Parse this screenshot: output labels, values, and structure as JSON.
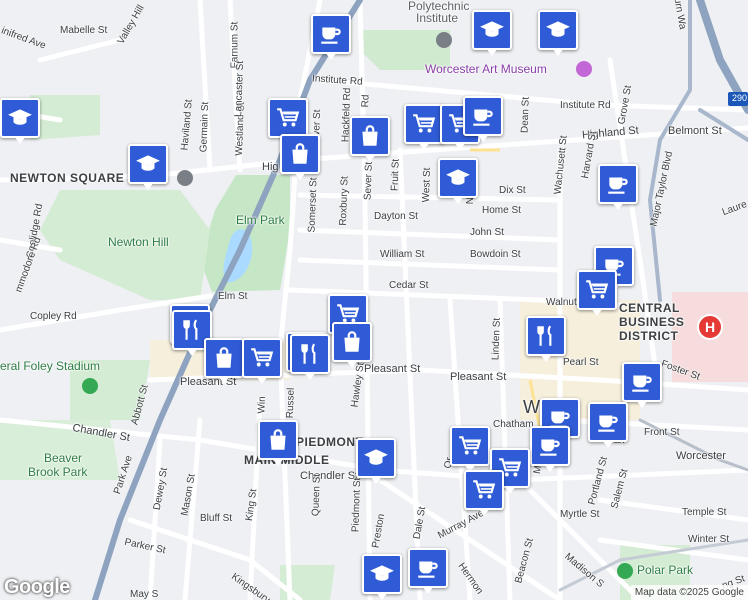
{
  "map": {
    "attribution": "Map data ©2025 Google",
    "logo": "Google",
    "hospital_symbol": "H",
    "colors": {
      "marker": "#2f5bd6",
      "park": "#c5e8c5",
      "highway": "#8ea3bf",
      "road": "#ffffff",
      "hospital": "#e53935"
    }
  },
  "labels": {
    "newton_square": "NEWTON SQUARE",
    "newton_square_2": "SQUARE",
    "elm_park": "Elm Park",
    "newton_hill": "Newton Hill",
    "central_business": "CENTRAL",
    "central_business_2": "BUSINESS",
    "central_business_3": "DISTRICT",
    "piedmont": "PIEDMONT",
    "main_middle": "MAIN MIDDLE",
    "polytechnic": "Polytechnic",
    "institute": "Institute",
    "art_museum": "Worcester Art Museum",
    "foley_stadium": "eral Foley Stadium",
    "beaver_brook": "Beaver",
    "beaver_brook_2": "Brook Park",
    "polar_park": "Polar Park",
    "worcester_city": "Worcester",
    "worcester_partial": "Wo",
    "hwy_290": "290",
    "streets": {
      "mabelle": "Mabelle St",
      "winifred": "inifred Ave",
      "valley_hill": "Valley Hill",
      "farnum": "Farnum St",
      "institute_rd": "Institute Rd",
      "institute_rd_2": "Institute Rd",
      "highland": "Highland St",
      "highland_left": "Hig",
      "belmont": "Belmont St",
      "haviland": "Haviland St",
      "germain": "Germain St",
      "westland": "Westland St",
      "lancaster": "Lancaster St",
      "dover": "Dover St",
      "hackfeld": "Hackfeld Rd",
      "rd": "Rd",
      "somerset": "Somerset St",
      "roxbury": "Roxbury St",
      "sever": "Sever St",
      "fruit": "Fruit St",
      "west": "West St",
      "n_ash": "N Ash",
      "dean": "Dean St",
      "dix": "Dix St",
      "home": "Home St",
      "dayton": "Dayton St",
      "john": "John St",
      "william": "William St",
      "bowdoin": "Bowdoin St",
      "cedar": "Cedar St",
      "walnut": "Walnut St",
      "elm": "Elm St",
      "copley": "Copley Rd",
      "coolidge": "Coolidge Rd",
      "commodore": "mmodore Rd",
      "pleasant_left": "Pleasant St",
      "pleasant_mid": "Pleasant St",
      "pleasant_right": "Pleasant St",
      "chandler_left": "Chandler St",
      "chandler_mid": "Chandler St",
      "chatham": "Chatham",
      "abbott": "Abbott St",
      "park_ave": "Park Ave",
      "dewey": "Dewey St",
      "mason": "Mason St",
      "king": "King St",
      "king_2": "Kingsbury",
      "queen": "Queen St",
      "piedmont_st": "Piedmont St",
      "preston": "Preston",
      "dale": "Dale St",
      "murray": "Murray Ave",
      "hermon": "Hermon",
      "beacon": "Beacon St",
      "madison": "Madison S",
      "bluff": "Bluff St",
      "parker": "Parker St",
      "may": "May S",
      "hawley": "Hawley St",
      "russell": "Russel",
      "wins": "Win",
      "linden": "Linden St",
      "pearl": "Pearl St",
      "foster": "Foster St",
      "front": "Front St",
      "harvard": "Harvard St",
      "wachusett": "Wachusett St",
      "grove": "Grove St",
      "major_taylor": "Major Taylor Blvd",
      "laure": "Laure",
      "portland": "Portland St",
      "salem": "Salem St",
      "myrtle": "Myrtle St",
      "temple": "Temple St",
      "winter": "Winter St",
      "or": "Or",
      "ma": "Ma",
      "fran": "Fran",
      "ng_st": "ng St",
      "auburn": "burn Wa",
      "arch": "Ch St"
    }
  },
  "markers": [
    {
      "type": "cafe",
      "name": "cafe-marker"
    },
    {
      "type": "school",
      "name": "school-marker"
    },
    {
      "type": "school",
      "name": "school-marker"
    },
    {
      "type": "school",
      "name": "school-marker"
    },
    {
      "type": "school",
      "name": "school-marker"
    },
    {
      "type": "shopping",
      "name": "shopping-cart-marker"
    },
    {
      "type": "bag",
      "name": "store-marker"
    },
    {
      "type": "bag",
      "name": "store-marker"
    },
    {
      "type": "shopping",
      "name": "shopping-cart-marker"
    },
    {
      "type": "shopping",
      "name": "shopping-cart-marker"
    },
    {
      "type": "cafe",
      "name": "cafe-marker"
    },
    {
      "type": "school",
      "name": "school-marker"
    },
    {
      "type": "cafe",
      "name": "cafe-marker"
    },
    {
      "type": "cafe",
      "name": "cafe-marker"
    },
    {
      "type": "shopping",
      "name": "shopping-cart-marker"
    },
    {
      "type": "restaurant",
      "name": "restaurant-marker"
    },
    {
      "type": "restaurant",
      "name": "restaurant-marker"
    },
    {
      "type": "bag",
      "name": "store-marker"
    },
    {
      "type": "shopping",
      "name": "shopping-cart-marker"
    },
    {
      "type": "restaurant",
      "name": "restaurant-marker"
    },
    {
      "type": "restaurant",
      "name": "restaurant-marker"
    },
    {
      "type": "shopping",
      "name": "shopping-cart-marker"
    },
    {
      "type": "bag",
      "name": "store-marker"
    },
    {
      "type": "restaurant",
      "name": "restaurant-marker"
    },
    {
      "type": "cafe",
      "name": "cafe-marker"
    },
    {
      "type": "cafe",
      "name": "cafe-marker"
    },
    {
      "type": "cafe",
      "name": "cafe-marker"
    },
    {
      "type": "cafe",
      "name": "cafe-marker"
    },
    {
      "type": "bag",
      "name": "store-marker"
    },
    {
      "type": "school",
      "name": "school-marker"
    },
    {
      "type": "shopping",
      "name": "shopping-cart-marker"
    },
    {
      "type": "shopping",
      "name": "shopping-cart-marker"
    },
    {
      "type": "shopping",
      "name": "shopping-cart-marker"
    },
    {
      "type": "school",
      "name": "school-marker"
    },
    {
      "type": "cafe",
      "name": "cafe-marker"
    }
  ]
}
